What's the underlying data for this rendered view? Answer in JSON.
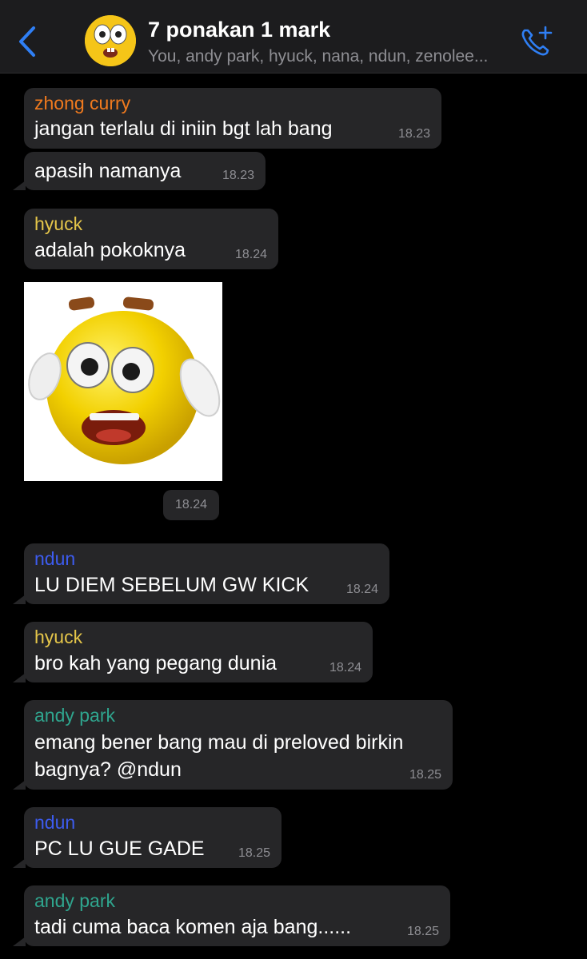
{
  "header": {
    "title": "7 ponakan 1 mark",
    "subtitle": "You, andy park, hyuck, nana, ndun, zenolee..."
  },
  "colors": {
    "zhong_curry": "#f07a1e",
    "hyuck": "#e5c64a",
    "ndun": "#3d5cf0",
    "andy_park": "#2fa58e",
    "accent": "#2f7ff5"
  },
  "icons": {
    "back": "chevron-left-icon",
    "avatar": "emoji-face-avatar",
    "call": "add-call-icon",
    "sticker": "scared-emoji-sticker"
  },
  "messages": [
    {
      "sender": "zhong curry",
      "text": "jangan terlalu di iniin bgt lah bang",
      "time": "18.23"
    },
    {
      "sender": "",
      "text": "apasih namanya",
      "time": "18.23"
    },
    {
      "sender": "hyuck",
      "text": "adalah pokoknya",
      "time": "18.24"
    },
    {
      "sticker_time": "18.24"
    },
    {
      "sender": "ndun",
      "text": "LU DIEM SEBELUM GW KICK",
      "time": "18.24"
    },
    {
      "sender": "hyuck",
      "text": "bro kah yang pegang dunia",
      "time": "18.24"
    },
    {
      "sender": "andy park",
      "text_line1": "emang bener bang mau di preloved birkin",
      "text_line2": "bagnya? @ndun",
      "time": "18.25"
    },
    {
      "sender": "ndun",
      "text": "PC LU GUE GADE",
      "time": "18.25"
    },
    {
      "sender": "andy park",
      "text": "tadi cuma baca komen aja bang......",
      "time": "18.25"
    }
  ]
}
